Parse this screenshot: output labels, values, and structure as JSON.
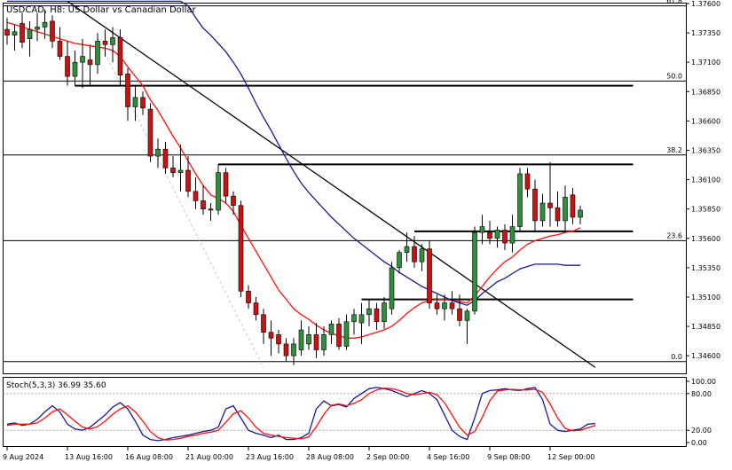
{
  "header": {
    "title": "USDCAD, H8:  US Dollar vs Canadian Dollar"
  },
  "stoch_label": "Stoch(5,3,3) 36.99 35.60",
  "colors": {
    "bull": "#2f8f3a",
    "bear": "#cc1111",
    "ma_fast": "#ff1010",
    "ma_slow": "#1a1a90",
    "stoch_k": "#1a1a90",
    "stoch_d": "#ff1010",
    "line": "#000000",
    "grid": "#a0a0a0"
  },
  "chart_data": [
    {
      "type": "candlestick",
      "title": "USDCAD, H8:  US Dollar vs Canadian Dollar",
      "ylim": [
        1.3445,
        1.376
      ],
      "price_ticks": [
        "1.37600",
        "1.37350",
        "1.37100",
        "1.36850",
        "1.36600",
        "1.36350",
        "1.36100",
        "1.35850",
        "1.35600",
        "1.35350",
        "1.35100",
        "1.34850",
        "1.34600"
      ],
      "time_labels": [
        {
          "i": 0,
          "label": "9 Aug 2024"
        },
        {
          "i": 8,
          "label": "13 Aug 16:00"
        },
        {
          "i": 16,
          "label": "16 Aug 08:00"
        },
        {
          "i": 24,
          "label": "21 Aug 00:00"
        },
        {
          "i": 32,
          "label": "23 Aug 16:00"
        },
        {
          "i": 40,
          "label": "28 Aug 08:00"
        },
        {
          "i": 48,
          "label": "2 Sep 00:00"
        },
        {
          "i": 56,
          "label": "4 Sep 16:00"
        },
        {
          "i": 64,
          "label": "9 Sep 08:00"
        },
        {
          "i": 72,
          "label": "12 Sep 00:00"
        }
      ],
      "fib_levels": [
        {
          "label": "61.8",
          "price": 1.3758
        },
        {
          "label": "50.0",
          "price": 1.3694
        },
        {
          "label": "38.2",
          "price": 1.3631
        },
        {
          "label": "23.6",
          "price": 1.3558
        },
        {
          "label": "0.0",
          "price": 1.3455
        }
      ],
      "candles": [
        {
          "o": 1.3738,
          "h": 1.3748,
          "l": 1.3725,
          "c": 1.3733
        },
        {
          "o": 1.3733,
          "h": 1.3742,
          "l": 1.372,
          "c": 1.3736
        },
        {
          "o": 1.3743,
          "h": 1.3752,
          "l": 1.3722,
          "c": 1.3727
        },
        {
          "o": 1.373,
          "h": 1.3745,
          "l": 1.3715,
          "c": 1.3738
        },
        {
          "o": 1.3738,
          "h": 1.3752,
          "l": 1.3728,
          "c": 1.374
        },
        {
          "o": 1.374,
          "h": 1.3755,
          "l": 1.373,
          "c": 1.3744
        },
        {
          "o": 1.3745,
          "h": 1.375,
          "l": 1.3722,
          "c": 1.3728
        },
        {
          "o": 1.3728,
          "h": 1.374,
          "l": 1.3712,
          "c": 1.3715
        },
        {
          "o": 1.3715,
          "h": 1.3728,
          "l": 1.369,
          "c": 1.3698
        },
        {
          "o": 1.3698,
          "h": 1.372,
          "l": 1.369,
          "c": 1.371
        },
        {
          "o": 1.371,
          "h": 1.373,
          "l": 1.3688,
          "c": 1.3715
        },
        {
          "o": 1.3712,
          "h": 1.3725,
          "l": 1.369,
          "c": 1.3708
        },
        {
          "o": 1.3708,
          "h": 1.3735,
          "l": 1.37,
          "c": 1.3728
        },
        {
          "o": 1.3728,
          "h": 1.3738,
          "l": 1.3715,
          "c": 1.3725
        },
        {
          "o": 1.3725,
          "h": 1.374,
          "l": 1.371,
          "c": 1.3731
        },
        {
          "o": 1.3731,
          "h": 1.3738,
          "l": 1.369,
          "c": 1.3699
        },
        {
          "o": 1.37,
          "h": 1.3705,
          "l": 1.366,
          "c": 1.3672
        },
        {
          "o": 1.3672,
          "h": 1.369,
          "l": 1.366,
          "c": 1.368
        },
        {
          "o": 1.368,
          "h": 1.3685,
          "l": 1.3665,
          "c": 1.3671
        },
        {
          "o": 1.367,
          "h": 1.3675,
          "l": 1.3625,
          "c": 1.363
        },
        {
          "o": 1.363,
          "h": 1.3645,
          "l": 1.362,
          "c": 1.3636
        },
        {
          "o": 1.3636,
          "h": 1.3642,
          "l": 1.3615,
          "c": 1.362
        },
        {
          "o": 1.362,
          "h": 1.363,
          "l": 1.3612,
          "c": 1.3616
        },
        {
          "o": 1.3616,
          "h": 1.364,
          "l": 1.36,
          "c": 1.3618
        },
        {
          "o": 1.3618,
          "h": 1.363,
          "l": 1.3595,
          "c": 1.36
        },
        {
          "o": 1.36,
          "h": 1.3612,
          "l": 1.3585,
          "c": 1.3592
        },
        {
          "o": 1.3592,
          "h": 1.3605,
          "l": 1.358,
          "c": 1.3585
        },
        {
          "o": 1.3585,
          "h": 1.359,
          "l": 1.3575,
          "c": 1.3584
        },
        {
          "o": 1.3584,
          "h": 1.3623,
          "l": 1.358,
          "c": 1.3616
        },
        {
          "o": 1.3616,
          "h": 1.362,
          "l": 1.359,
          "c": 1.3596
        },
        {
          "o": 1.3596,
          "h": 1.36,
          "l": 1.358,
          "c": 1.3588
        },
        {
          "o": 1.3588,
          "h": 1.3592,
          "l": 1.351,
          "c": 1.3515
        },
        {
          "o": 1.3515,
          "h": 1.352,
          "l": 1.35,
          "c": 1.3505
        },
        {
          "o": 1.3505,
          "h": 1.351,
          "l": 1.349,
          "c": 1.3495
        },
        {
          "o": 1.3495,
          "h": 1.35,
          "l": 1.347,
          "c": 1.348
        },
        {
          "o": 1.348,
          "h": 1.349,
          "l": 1.346,
          "c": 1.3475
        },
        {
          "o": 1.3478,
          "h": 1.3482,
          "l": 1.3462,
          "c": 1.347
        },
        {
          "o": 1.347,
          "h": 1.3475,
          "l": 1.3455,
          "c": 1.346
        },
        {
          "o": 1.346,
          "h": 1.3475,
          "l": 1.3452,
          "c": 1.347
        },
        {
          "o": 1.3465,
          "h": 1.349,
          "l": 1.346,
          "c": 1.3482
        },
        {
          "o": 1.347,
          "h": 1.3485,
          "l": 1.3465,
          "c": 1.3478
        },
        {
          "o": 1.3478,
          "h": 1.3488,
          "l": 1.3458,
          "c": 1.3465
        },
        {
          "o": 1.3465,
          "h": 1.3485,
          "l": 1.346,
          "c": 1.3478
        },
        {
          "o": 1.3478,
          "h": 1.349,
          "l": 1.347,
          "c": 1.3487
        },
        {
          "o": 1.3487,
          "h": 1.3492,
          "l": 1.3465,
          "c": 1.3468
        },
        {
          "o": 1.3468,
          "h": 1.3495,
          "l": 1.3465,
          "c": 1.3489
        },
        {
          "o": 1.3489,
          "h": 1.35,
          "l": 1.3478,
          "c": 1.3495
        },
        {
          "o": 1.3488,
          "h": 1.3505,
          "l": 1.347,
          "c": 1.3495
        },
        {
          "o": 1.3495,
          "h": 1.3508,
          "l": 1.3485,
          "c": 1.35
        },
        {
          "o": 1.35,
          "h": 1.3505,
          "l": 1.3482,
          "c": 1.3489
        },
        {
          "o": 1.3489,
          "h": 1.351,
          "l": 1.3483,
          "c": 1.3505
        },
        {
          "o": 1.35,
          "h": 1.354,
          "l": 1.3495,
          "c": 1.3535
        },
        {
          "o": 1.3535,
          "h": 1.355,
          "l": 1.353,
          "c": 1.3548
        },
        {
          "o": 1.3548,
          "h": 1.3565,
          "l": 1.354,
          "c": 1.3553
        },
        {
          "o": 1.3553,
          "h": 1.3562,
          "l": 1.3535,
          "c": 1.354
        },
        {
          "o": 1.354,
          "h": 1.3555,
          "l": 1.3532,
          "c": 1.3551
        },
        {
          "o": 1.3551,
          "h": 1.3558,
          "l": 1.35,
          "c": 1.3505
        },
        {
          "o": 1.3505,
          "h": 1.3512,
          "l": 1.3495,
          "c": 1.35
        },
        {
          "o": 1.35,
          "h": 1.3512,
          "l": 1.349,
          "c": 1.3505
        },
        {
          "o": 1.3505,
          "h": 1.3515,
          "l": 1.3495,
          "c": 1.35
        },
        {
          "o": 1.35,
          "h": 1.3512,
          "l": 1.3485,
          "c": 1.349
        },
        {
          "o": 1.349,
          "h": 1.35,
          "l": 1.347,
          "c": 1.3498
        },
        {
          "o": 1.3498,
          "h": 1.357,
          "l": 1.3495,
          "c": 1.3565
        },
        {
          "o": 1.3565,
          "h": 1.358,
          "l": 1.3555,
          "c": 1.357
        },
        {
          "o": 1.3565,
          "h": 1.3575,
          "l": 1.3555,
          "c": 1.356
        },
        {
          "o": 1.356,
          "h": 1.357,
          "l": 1.3552,
          "c": 1.3567
        },
        {
          "o": 1.3567,
          "h": 1.3572,
          "l": 1.355,
          "c": 1.3556
        },
        {
          "o": 1.3556,
          "h": 1.358,
          "l": 1.3548,
          "c": 1.357
        },
        {
          "o": 1.357,
          "h": 1.362,
          "l": 1.3565,
          "c": 1.3615
        },
        {
          "o": 1.3615,
          "h": 1.362,
          "l": 1.3595,
          "c": 1.3602
        },
        {
          "o": 1.3602,
          "h": 1.361,
          "l": 1.3565,
          "c": 1.3575
        },
        {
          "o": 1.3575,
          "h": 1.3598,
          "l": 1.357,
          "c": 1.359
        },
        {
          "o": 1.359,
          "h": 1.3625,
          "l": 1.357,
          "c": 1.3586
        },
        {
          "o": 1.3586,
          "h": 1.36,
          "l": 1.357,
          "c": 1.3575
        },
        {
          "o": 1.3575,
          "h": 1.3605,
          "l": 1.3565,
          "c": 1.3595
        },
        {
          "o": 1.3597,
          "h": 1.3603,
          "l": 1.3572,
          "c": 1.3578
        },
        {
          "o": 1.3578,
          "h": 1.3588,
          "l": 1.3572,
          "c": 1.3584
        }
      ],
      "series": [
        {
          "name": "MA fast",
          "values": [
            1.3744,
            1.3742,
            1.374,
            1.3738,
            1.3736,
            1.3734,
            1.3732,
            1.373,
            1.3728,
            1.3726,
            1.3725,
            1.3724,
            1.3723,
            1.3722,
            1.372,
            1.3715,
            1.3706,
            1.3698,
            1.369,
            1.3678,
            1.3669,
            1.3658,
            1.3647,
            1.3637,
            1.3626,
            1.3615,
            1.3605,
            1.3597,
            1.3594,
            1.359,
            1.3583,
            1.3571,
            1.356,
            1.3549,
            1.3538,
            1.3527,
            1.3516,
            1.3508,
            1.35,
            1.3495,
            1.3491,
            1.3486,
            1.3482,
            1.3479,
            1.3477,
            1.3475,
            1.3475,
            1.3476,
            1.3478,
            1.348,
            1.3482,
            1.3485,
            1.349,
            1.3496,
            1.3501,
            1.3505,
            1.3507,
            1.3508,
            1.3508,
            1.3507,
            1.3506,
            1.3505,
            1.3511,
            1.3519,
            1.3527,
            1.3534,
            1.354,
            1.3544,
            1.355,
            1.3555,
            1.3558,
            1.356,
            1.3562,
            1.3563,
            1.3565,
            1.3566,
            1.3569
          ]
        },
        {
          "name": "MA slow",
          "values": [
            1.3762,
            1.3762,
            1.3762,
            1.3762,
            1.3762,
            1.3762,
            1.3762,
            1.3762,
            1.3762,
            1.3762,
            1.3762,
            1.3762,
            1.3762,
            1.3762,
            1.3762,
            1.3762,
            1.3762,
            1.3762,
            1.3762,
            1.3762,
            1.3762,
            1.3762,
            1.3762,
            1.3762,
            1.3758,
            1.3748,
            1.3739,
            1.3733,
            1.3726,
            1.3719,
            1.371,
            1.37,
            1.3688,
            1.3675,
            1.3663,
            1.3652,
            1.364,
            1.3628,
            1.3617,
            1.3607,
            1.3599,
            1.3592,
            1.3585,
            1.3578,
            1.3572,
            1.3566,
            1.356,
            1.3555,
            1.355,
            1.3545,
            1.354,
            1.3536,
            1.3531,
            1.3527,
            1.3523,
            1.3519,
            1.3516,
            1.3513,
            1.351,
            1.3507,
            1.3505,
            1.3503,
            1.3507,
            1.3513,
            1.3518,
            1.3523,
            1.3526,
            1.353,
            1.3534,
            1.3536,
            1.3538,
            1.3538,
            1.3538,
            1.3538,
            1.3537,
            1.3537,
            1.3537
          ]
        }
      ],
      "annotations": {
        "trendlines": [
          {
            "from": {
              "i": 8,
              "p": 1.3762
            },
            "to": {
              "i": 78,
              "p": 1.345
            }
          },
          {
            "from": {
              "i": 12,
              "p": 1.373
            },
            "to": {
              "i": 34,
              "p": 1.345
            }
          }
        ],
        "horizontal_segments": [
          {
            "from_i": 9,
            "to_i": 83,
            "price": 1.369
          },
          {
            "from_i": 28,
            "to_i": 83,
            "price": 1.3623
          },
          {
            "from_i": 54,
            "to_i": 83,
            "price": 1.3566
          },
          {
            "from_i": 47,
            "to_i": 83,
            "price": 1.3508
          }
        ]
      }
    },
    {
      "type": "line",
      "title": "Stoch(5,3,3) 36.99 35.60",
      "ylim": [
        0,
        100
      ],
      "y_ticks": [
        "100.00",
        "80.00",
        "20.00",
        "0.00"
      ],
      "levels": [
        80,
        20
      ],
      "series": [
        {
          "name": "%K",
          "values": [
            30,
            32,
            28,
            30,
            38,
            50,
            60,
            50,
            30,
            22,
            20,
            25,
            35,
            45,
            58,
            65,
            55,
            35,
            12,
            5,
            3,
            5,
            8,
            10,
            12,
            15,
            18,
            20,
            25,
            55,
            60,
            40,
            20,
            15,
            12,
            8,
            12,
            5,
            5,
            8,
            15,
            55,
            68,
            60,
            62,
            58,
            72,
            80,
            88,
            90,
            88,
            85,
            80,
            75,
            80,
            85,
            80,
            70,
            45,
            20,
            10,
            5,
            40,
            80,
            85,
            86,
            88,
            86,
            85,
            88,
            90,
            70,
            30,
            20,
            18,
            20,
            22,
            30,
            31
          ]
        },
        {
          "name": "%D",
          "values": [
            28,
            30,
            30,
            30,
            32,
            40,
            50,
            55,
            45,
            35,
            25,
            22,
            26,
            35,
            46,
            55,
            60,
            50,
            35,
            18,
            8,
            4,
            5,
            7,
            10,
            12,
            15,
            17,
            20,
            33,
            47,
            52,
            40,
            25,
            15,
            12,
            10,
            8,
            7,
            6,
            9,
            26,
            46,
            61,
            63,
            60,
            64,
            70,
            80,
            86,
            89,
            88,
            85,
            80,
            78,
            80,
            82,
            78,
            65,
            45,
            25,
            12,
            18,
            41,
            68,
            84,
            86,
            87,
            86,
            86,
            87,
            82,
            63,
            40,
            23,
            19,
            20,
            24,
            28
          ]
        }
      ]
    }
  ]
}
